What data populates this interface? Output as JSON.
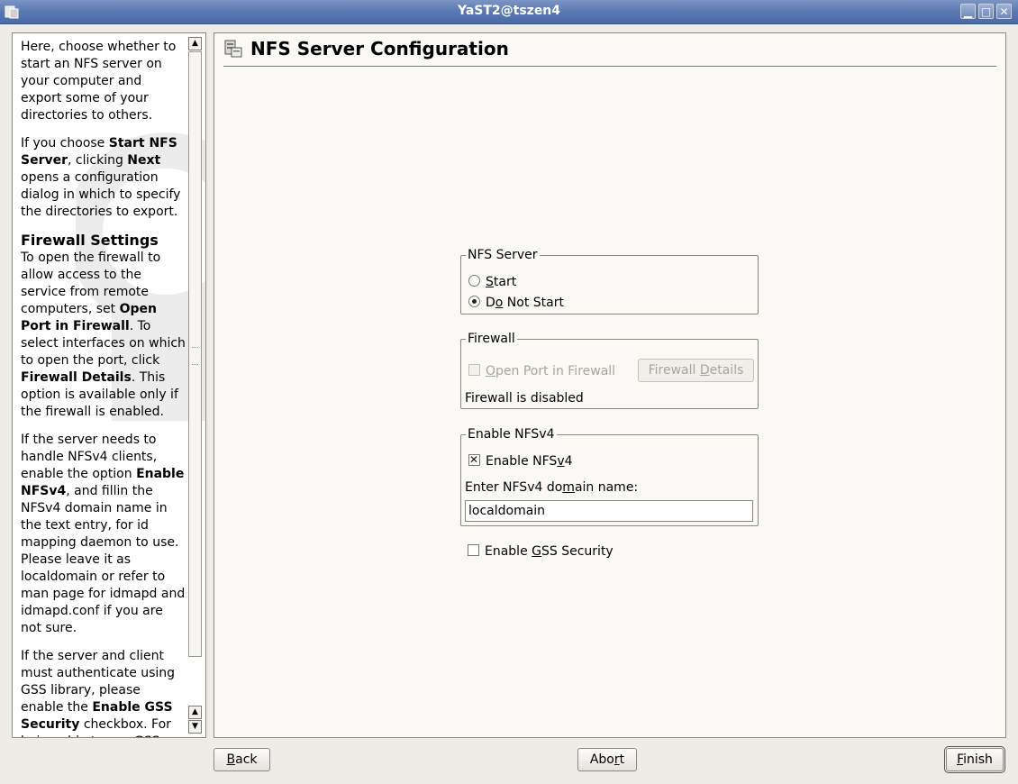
{
  "window": {
    "title": "YaST2@tszen4",
    "icon": "yast-app-icon"
  },
  "help": {
    "p1": "Here, choose whether to start an NFS server on your computer and export some of your directories to others.",
    "p2_a": "If you choose ",
    "p2_b": "Start NFS Server",
    "p2_c": ", clicking ",
    "p2_d": "Next",
    "p2_e": " opens a configuration dialog in which to specify the directories to export.",
    "firewall_heading": "Firewall Settings",
    "p3_a": "To open the firewall to allow access to the service from remote computers, set ",
    "p3_b": "Open Port in Firewall",
    "p3_c": ". To select interfaces on which to open the port, click ",
    "p3_d": "Firewall Details",
    "p3_e": ". This option is available only if the firewall is enabled.",
    "p4_a": "If the server needs to handle NFSv4 clients, enable the option ",
    "p4_b": "Enable NFSv4",
    "p4_c": ", and fillin the NFSv4 domain name in the text entry, for id mapping daemon to use. Please leave it as localdomain or refer to man page for idmapd and idmapd.conf if you are not sure.",
    "p5_a": "If the server and client must authenticate using GSS library, please enable the ",
    "p5_b": "Enable GSS Security",
    "p5_c": " checkbox. For being able to use GSS API, currently"
  },
  "main": {
    "title": "NFS Server Configuration",
    "nfs_server": {
      "legend": "NFS Server",
      "start_label": "Start",
      "start_mnemonic": "S",
      "start_rest": "tart",
      "donot_label": "Do Not Start",
      "donot_a": "D",
      "donot_m": "o",
      "donot_b": " Not Start",
      "selected": "Do Not Start"
    },
    "firewall": {
      "legend": "Firewall",
      "open_port_label": "Open Port in Firewall",
      "open_port_m": "O",
      "open_port_rest": "pen Port in Firewall",
      "details_a": "Firewall ",
      "details_m": "D",
      "details_b": "etails",
      "status": "Firewall is disabled"
    },
    "nfsv4": {
      "legend": "Enable NFSv4",
      "checkbox_a": "Enable NFS",
      "checkbox_m": "v",
      "checkbox_b": "4",
      "checked": true,
      "domain_label_a": "Enter NFSv4 do",
      "domain_label_m": "m",
      "domain_label_b": "ain name:",
      "domain_value": "localdomain"
    },
    "gss": {
      "label_a": "Enable ",
      "label_m": "G",
      "label_b": "SS Security",
      "checked": false
    }
  },
  "footer": {
    "back_m": "B",
    "back_rest": "ack",
    "abort_a": "Abo",
    "abort_m": "r",
    "abort_b": "t",
    "finish_m": "F",
    "finish_rest": "inish"
  }
}
